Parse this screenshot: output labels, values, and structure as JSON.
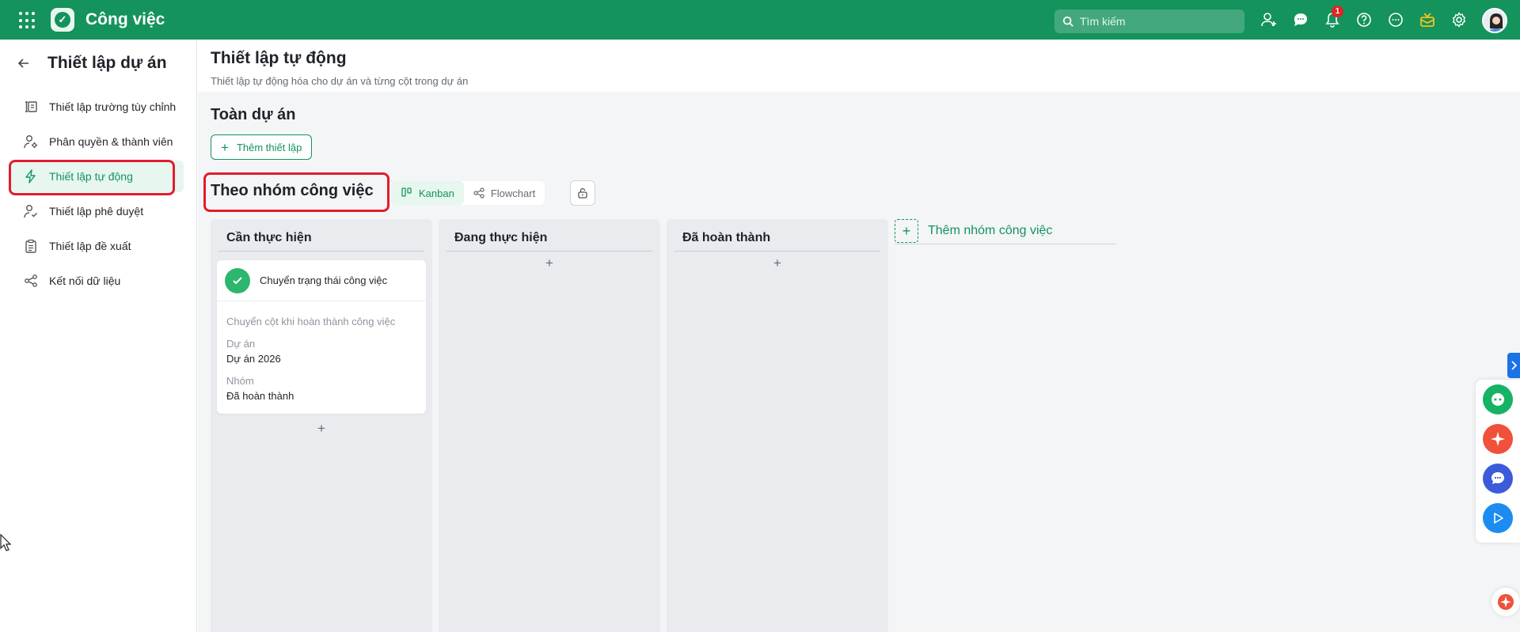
{
  "app": {
    "title": "Công việc"
  },
  "search": {
    "placeholder": "Tìm kiếm"
  },
  "notifications": {
    "count": "1"
  },
  "sidebar": {
    "title": "Thiết lập dự án",
    "items": [
      {
        "label": "Thiết lập trường tùy chỉnh",
        "icon": "custom-field-icon"
      },
      {
        "label": "Phân quyền & thành viên",
        "icon": "user-gear-icon"
      },
      {
        "label": "Thiết lập tự động",
        "icon": "lightning-icon",
        "active": true
      },
      {
        "label": "Thiết lập phê duyệt",
        "icon": "user-check-icon"
      },
      {
        "label": "Thiết lập đề xuất",
        "icon": "clipboard-icon"
      },
      {
        "label": "Kết nối dữ liệu",
        "icon": "share-nodes-icon"
      }
    ]
  },
  "main": {
    "title": "Thiết lập tự động",
    "subtitle": "Thiết lập tự động hóa cho dự án và từng cột trong dự án",
    "whole_project": {
      "title": "Toàn dự án",
      "add_button": "Thêm thiết lập"
    },
    "by_group": {
      "title": "Theo nhóm công việc",
      "views": [
        {
          "label": "Kanban",
          "active": true
        },
        {
          "label": "Flowchart",
          "active": false
        }
      ],
      "columns": [
        {
          "title": "Cần thực hiện",
          "card": {
            "title": "Chuyển trạng thái công việc",
            "description": "Chuyển cột khi hoàn thành công việc",
            "fields": [
              {
                "label": "Dự án",
                "value": "Dự án 2026"
              },
              {
                "label": "Nhóm",
                "value": "Đã hoàn thành"
              }
            ]
          }
        },
        {
          "title": "Đang thực hiện"
        },
        {
          "title": "Đã hoàn thành"
        }
      ],
      "add_group": "Thêm nhóm công việc"
    }
  },
  "colors": {
    "brand": "#14935d",
    "active_bg": "#e7f6ee",
    "highlight": "#e11d2e"
  }
}
